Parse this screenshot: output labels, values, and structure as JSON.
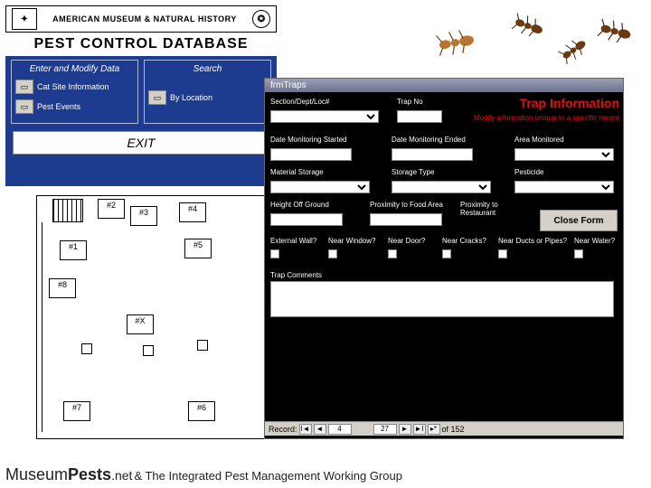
{
  "menu": {
    "amnh_text": "AMERICAN MUSEUM & NATURAL HISTORY",
    "title": "PEST CONTROL DATABASE",
    "col1_title": "Enter and Modify Data",
    "col2_title": "Search",
    "btn_trap": "Cat Site Information",
    "btn_pest": "Pest Events",
    "btn_location": "By Location",
    "exit": "EXIT"
  },
  "floorplan": {
    "r1": "#1",
    "r2": "#2",
    "r3": "#3",
    "r4": "#4",
    "r5": "#5",
    "r6": "#6",
    "r7": "#7",
    "r8": "#8",
    "rx": "#X"
  },
  "form": {
    "window_title": "frmTraps",
    "heading": "Trap Information",
    "subheading": "Modify information unique to a specific record",
    "section_label": "Section/Dept/Loc#",
    "trapno_label": "Trap No",
    "date_start_label": "Date Monitoring Started",
    "date_end_label": "Date Monitoring Ended",
    "area_label": "Area Monitored",
    "material_label": "Material Storage",
    "storage_label": "Storage Type",
    "pesticide_label": "Pesticide",
    "height_label": "Height Off Ground",
    "food_label": "Proximity to Food Area",
    "restaurant_label": "Proximity to Restaurant",
    "ext_wall": "External Wall?",
    "near_window": "Near Window?",
    "near_door": "Near Door?",
    "near_cracks": "Near Cracks?",
    "near_ducts": "Near Ducts or Pipes?",
    "near_water": "Near Water?",
    "comments_label": "Trap Comments",
    "close_btn": "Close Form",
    "rec_label": "Record:",
    "rec_cur": "4",
    "rec_pos": "27",
    "rec_total": "of 152"
  },
  "footer": {
    "brand_a": "Museum",
    "brand_b": "Pests",
    "brand_c": ".net",
    "text": "& The Integrated Pest Management Working Group"
  }
}
